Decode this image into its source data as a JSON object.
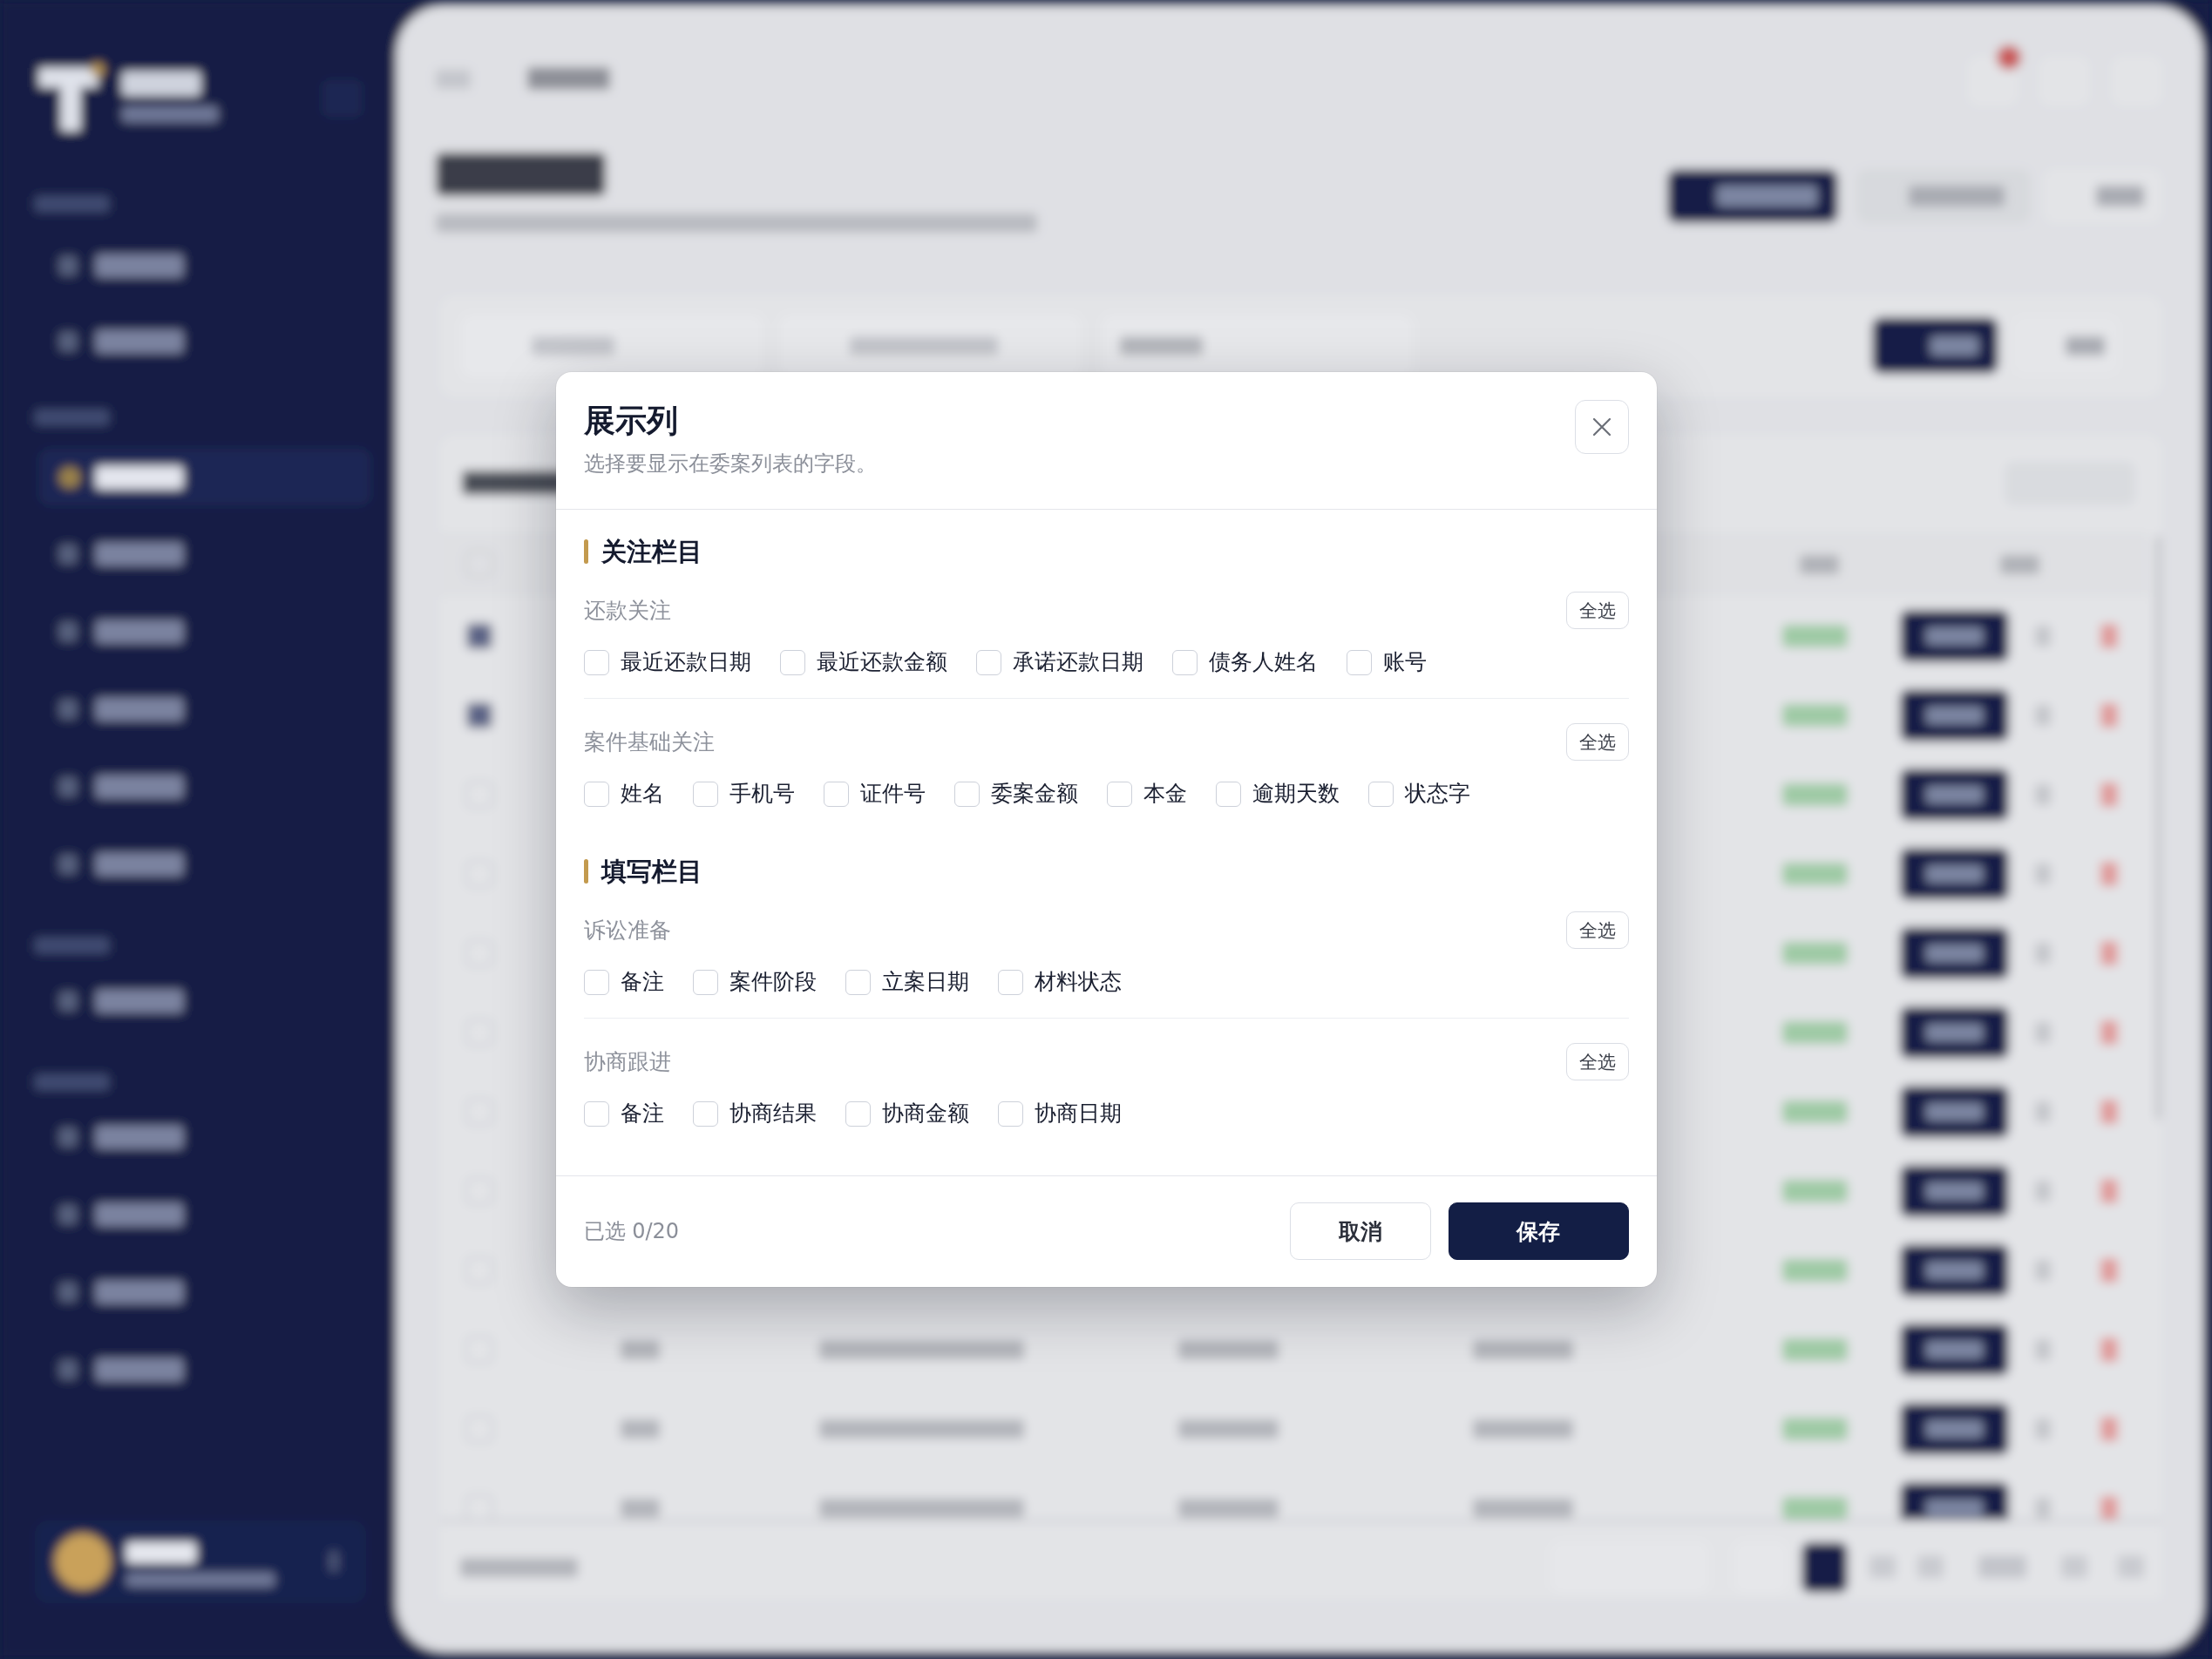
{
  "dialog": {
    "title": "展示列",
    "subtitle": "选择要显示在委案列表的字段。",
    "sections": [
      {
        "title": "关注栏目",
        "groups": [
          {
            "label": "还款关注",
            "select_all": "全选",
            "fields": [
              {
                "label": "最近还款日期",
                "checked": false
              },
              {
                "label": "最近还款金额",
                "checked": false
              },
              {
                "label": "承诺还款日期",
                "checked": false
              },
              {
                "label": "债务人姓名",
                "checked": false
              },
              {
                "label": "账号",
                "checked": false
              }
            ]
          },
          {
            "label": "案件基础关注",
            "select_all": "全选",
            "fields": [
              {
                "label": "姓名",
                "checked": false
              },
              {
                "label": "手机号",
                "checked": false
              },
              {
                "label": "证件号",
                "checked": false
              },
              {
                "label": "委案金额",
                "checked": false
              },
              {
                "label": "本金",
                "checked": false
              },
              {
                "label": "逾期天数",
                "checked": false
              },
              {
                "label": "状态字",
                "checked": false
              }
            ]
          }
        ]
      },
      {
        "title": "填写栏目",
        "groups": [
          {
            "label": "诉讼准备",
            "select_all": "全选",
            "fields": [
              {
                "label": "备注",
                "checked": false
              },
              {
                "label": "案件阶段",
                "checked": false
              },
              {
                "label": "立案日期",
                "checked": false
              },
              {
                "label": "材料状态",
                "checked": false
              }
            ]
          },
          {
            "label": "协商跟进",
            "select_all": "全选",
            "fields": [
              {
                "label": "备注",
                "checked": false
              },
              {
                "label": "协商结果",
                "checked": false
              },
              {
                "label": "协商金额",
                "checked": false
              },
              {
                "label": "协商日期",
                "checked": false
              }
            ]
          }
        ]
      }
    ],
    "footer": {
      "selected_count": "已选 0/20",
      "buttons": [
        {
          "label": "取消",
          "kind": "secondary"
        },
        {
          "label": "保存",
          "kind": "primary"
        }
      ]
    }
  }
}
